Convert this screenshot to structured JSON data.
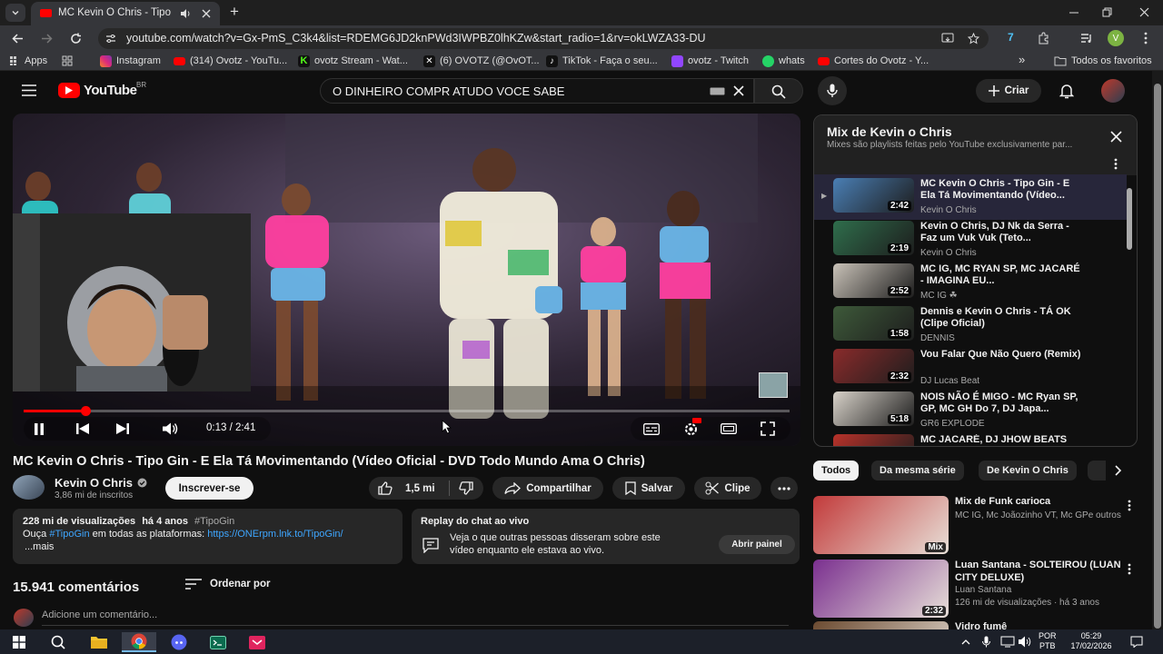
{
  "browser": {
    "tab_title": "MC Kevin O Chris - Tipo Gin",
    "new_tab_symbol": "+",
    "url": "youtube.com/watch?v=Gx-PmS_C3k4&list=RDEMG6JD2knPWd3IWPBZ0lhKZw&start_radio=1&rv=okLWZA33-DU",
    "profile_initial": "V",
    "bookmarks": [
      {
        "label": "Apps",
        "icon": "grid-icon",
        "color": "#9aa0a6"
      },
      {
        "label": "Instagram",
        "icon": "instagram-icon",
        "color": "#d6249f"
      },
      {
        "label": "(314) Ovotz - YouTu...",
        "icon": "youtube-icon",
        "color": "#ff0000"
      },
      {
        "label": "ovotz Stream - Wat...",
        "icon": "kick-icon",
        "color": "#53fc18"
      },
      {
        "label": "(6) OVOTZ (@OvOT...",
        "icon": "x-icon",
        "color": "#ffffff"
      },
      {
        "label": "TikTok - Faça o seu...",
        "icon": "tiktok-icon",
        "color": "#ffffff"
      },
      {
        "label": "ovotz - Twitch",
        "icon": "twitch-icon",
        "color": "#9146ff"
      },
      {
        "label": "whats",
        "icon": "whatsapp-icon",
        "color": "#25d366"
      },
      {
        "label": "Cortes do Ovotz - Y...",
        "icon": "youtube-icon",
        "color": "#ff0000"
      }
    ],
    "all_bookmarks": "Todos os favoritos",
    "more_symbol": "»"
  },
  "yt": {
    "logo_text": "YouTube",
    "region": "BR",
    "search_value": "O DINHEIRO COMPR ATUDO VOCE SABE",
    "create_label": "Criar"
  },
  "player": {
    "time": "0:13 / 2:41",
    "progress_fraction": 0.081
  },
  "video": {
    "title": "MC Kevin O Chris - Tipo Gin - E Ela Tá Movimentando (Vídeo Oficial - DVD Todo Mundo Ama O Chris)",
    "channel": "Kevin O Chris",
    "subscribers": "3,86 mi de inscritos",
    "subscribe_label": "Inscrever-se",
    "likes": "1,5 mi",
    "share_label": "Compartilhar",
    "save_label": "Salvar",
    "clip_label": "Clipe",
    "views": "228 mi de visualizações",
    "age": "há 4 anos",
    "hashtag": "#TipoGin",
    "desc_prefix": "Ouça",
    "desc_hashtag": "#TipoGin",
    "desc_mid": "em todas as plataformas:",
    "desc_link": "https://ONErpm.lnk.to/TipoGin/",
    "desc_more": "...mais"
  },
  "chat_replay": {
    "title": "Replay do chat ao vivo",
    "body_line1": "Veja o que outras pessoas disseram sobre este",
    "body_line2": "vídeo enquanto ele estava ao vivo.",
    "button": "Abrir painel"
  },
  "comments": {
    "count": "15.941 comentários",
    "sort_label": "Ordenar por",
    "add_placeholder": "Adicione um comentário..."
  },
  "playlist": {
    "title": "Mix de Kevin o Chris",
    "subtitle": "Mixes são playlists feitas pelo YouTube exclusivamente par...",
    "items": [
      {
        "title": "MC Kevin O Chris - Tipo Gin - E Ela Tá Movimentando (Vídeo...",
        "channel": "Kevin O Chris",
        "duration": "2:42",
        "thumb_color": "#4a7fb5",
        "active": true
      },
      {
        "title": "Kevin O Chris, DJ Nk da Serra - Faz um Vuk Vuk (Teto...",
        "channel": "Kevin O Chris",
        "duration": "2:19",
        "thumb_color": "#2f6e4c",
        "active": false
      },
      {
        "title": "MC IG, MC RYAN SP, MC JACARÉ - IMAGINA EU...",
        "channel": "MC IG ☘",
        "duration": "2:52",
        "thumb_color": "#c9c2b8",
        "active": false
      },
      {
        "title": "Dennis e Kevin O Chris - TÁ OK (Clipe Oficial)",
        "channel": "DENNIS",
        "duration": "1:58",
        "thumb_color": "#3e5a3a",
        "active": false
      },
      {
        "title": "Vou Falar Que Não Quero (Remix)",
        "channel": "DJ Lucas Beat",
        "duration": "2:32",
        "thumb_color": "#8a2b2b",
        "active": false
      },
      {
        "title": "NOIS NÃO É MIGO - MC Ryan SP, GP, MC GH Do 7, DJ Japa...",
        "channel": "GR6 EXPLODE",
        "duration": "5:18",
        "thumb_color": "#d8d2c9",
        "active": false
      },
      {
        "title": "MC JACARÉ, DJ JHOW BEATS",
        "channel": "",
        "duration": "",
        "thumb_color": "#b8322a",
        "active": false
      }
    ]
  },
  "chips": [
    "Todos",
    "Da mesma série",
    "De Kevin O Chris"
  ],
  "recommendations": [
    {
      "title": "Mix de Funk carioca",
      "meta1": "MC IG, Mc Joãozinho VT, Mc GPe outros",
      "meta2": "",
      "badge": "Mix",
      "thumb_color": "#c23a3a"
    },
    {
      "title": "Luan Santana - SOLTEIROU (LUAN CITY DELUXE)",
      "meta1": "Luan Santana",
      "meta2": "126 mi de visualizações · há 3 anos",
      "badge": "2:32",
      "thumb_color": "#7a2f8f"
    },
    {
      "title": "Vidro fumê",
      "meta1": "",
      "meta2": "",
      "badge": "",
      "thumb_color": "#6b4a30"
    }
  ],
  "taskbar": {
    "lang_line1": "POR",
    "lang_line2": "PTB",
    "time": "05:29",
    "date": "17/02/2026"
  }
}
